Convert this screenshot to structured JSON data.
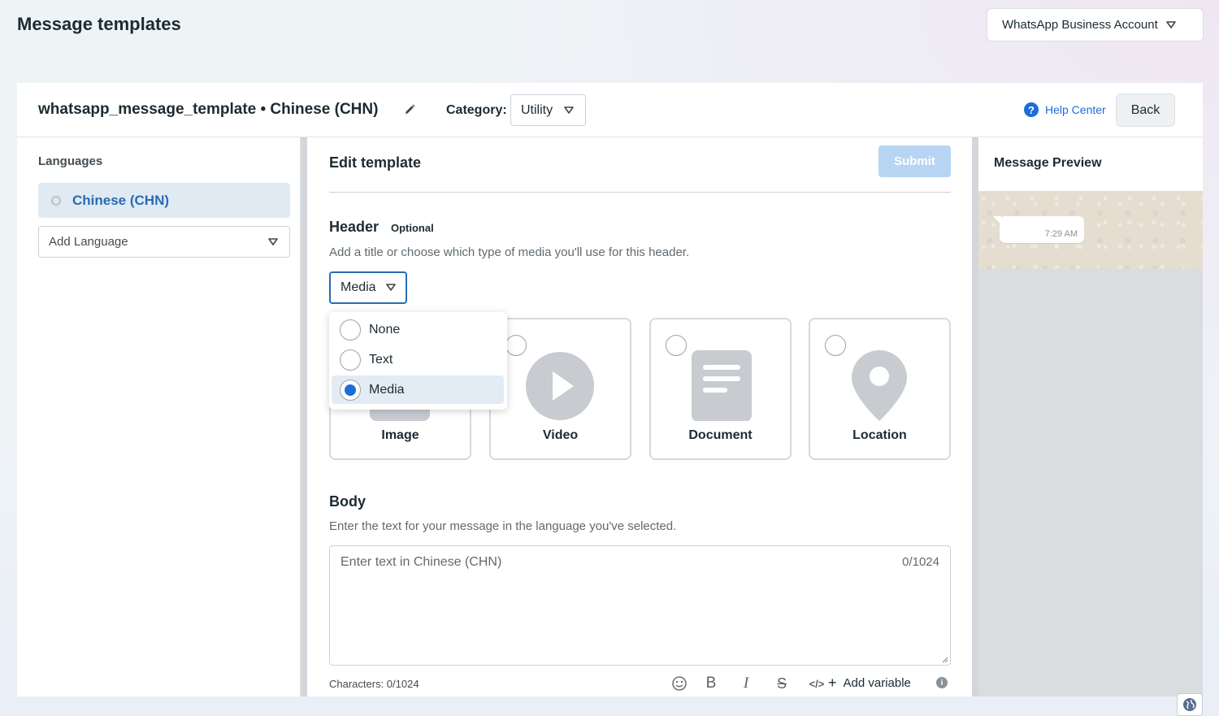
{
  "page": {
    "title": "Message templates",
    "account_select": "WhatsApp Business Account"
  },
  "topbar": {
    "template_name": "whatsapp_message_template • Chinese (CHN)",
    "category_label": "Category:",
    "category_value": "Utility",
    "help_center": "Help Center",
    "back_label": "Back"
  },
  "languages": {
    "title": "Languages",
    "items": [
      {
        "label": "Chinese (CHN)"
      }
    ],
    "add_language_placeholder": "Add Language"
  },
  "editor": {
    "title": "Edit template",
    "submit_label": "Submit",
    "header": {
      "title": "Header",
      "optional": "Optional",
      "description": "Add a title or choose which type of media you'll use for this header.",
      "type_value": "Media",
      "options": [
        {
          "label": "None",
          "selected": false
        },
        {
          "label": "Text",
          "selected": false
        },
        {
          "label": "Media",
          "selected": true
        }
      ],
      "media_cards": [
        {
          "label": "Image",
          "icon": "image-icon"
        },
        {
          "label": "Video",
          "icon": "play-icon"
        },
        {
          "label": "Document",
          "icon": "document-icon"
        },
        {
          "label": "Location",
          "icon": "location-pin-icon"
        }
      ]
    },
    "body": {
      "title": "Body",
      "description": "Enter the text for your message in the language you've selected.",
      "placeholder": "Enter text in Chinese (CHN)",
      "counter": "0/1024",
      "characters_label": "Characters: 0/1024",
      "toolbar": {
        "bold": "B",
        "italic": "I",
        "strike": "S",
        "code": "</>",
        "add_variable": "Add variable"
      }
    }
  },
  "preview": {
    "title": "Message Preview",
    "bubble_time": "7:29 AM"
  },
  "colors": {
    "accent": "#1a6ed8",
    "selected_language_bg": "#e0eaf2",
    "submit_disabled": "#b7d5f3"
  }
}
